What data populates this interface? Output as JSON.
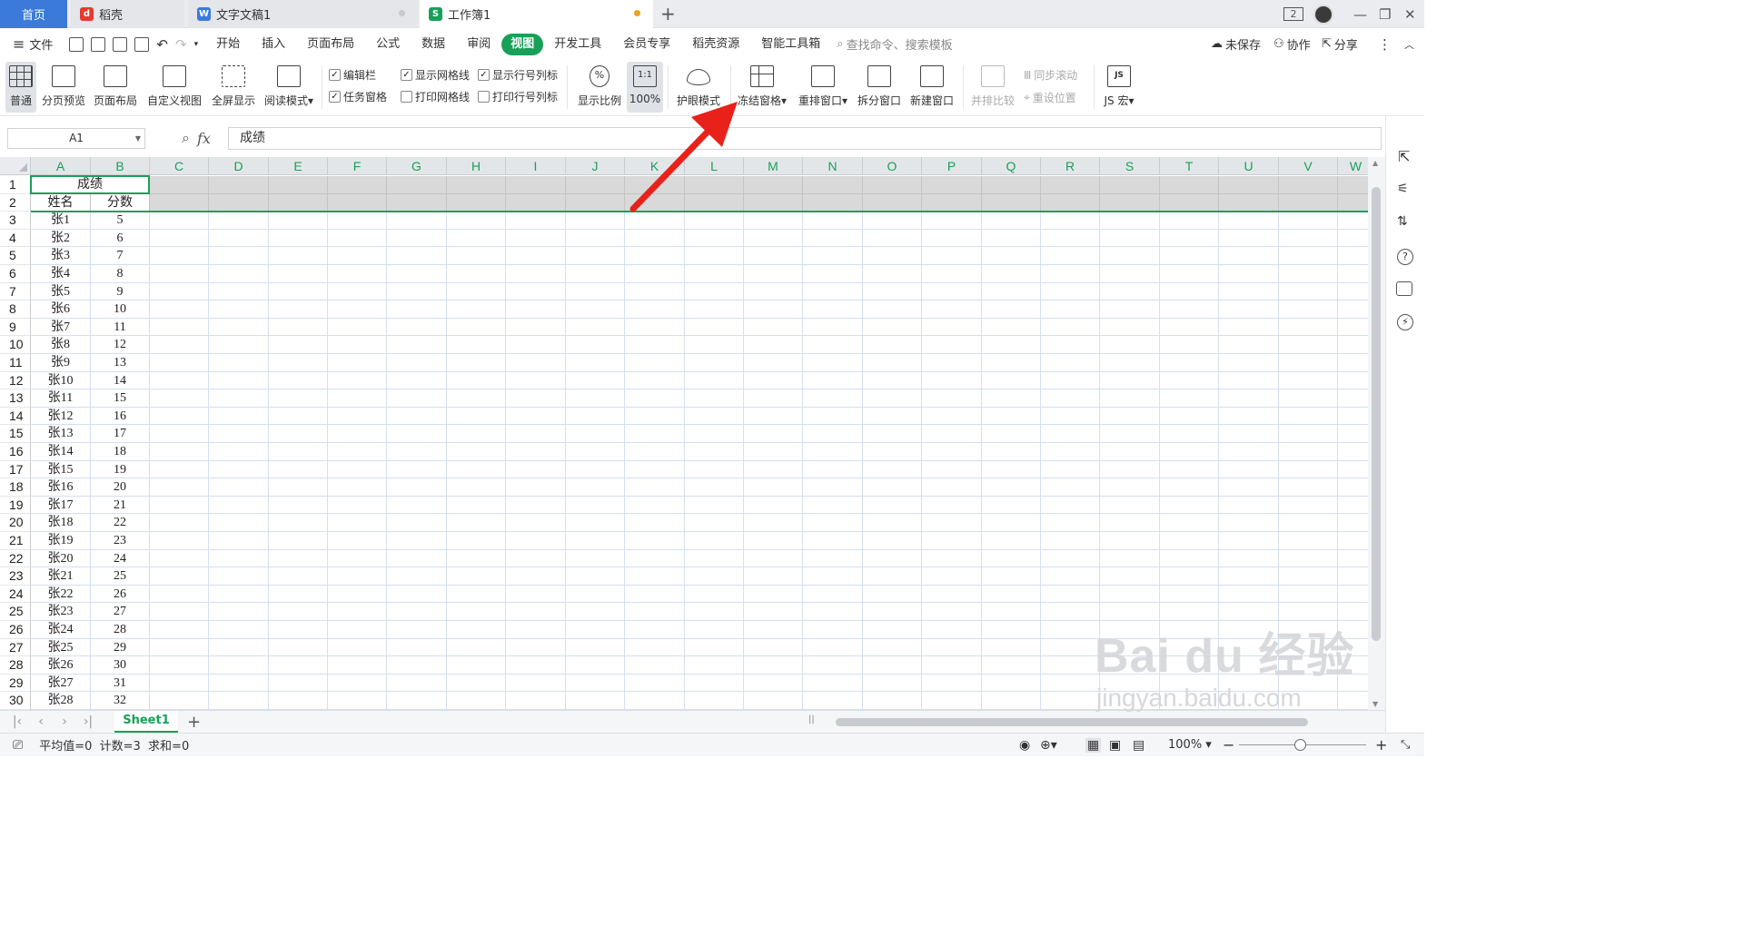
{
  "tabs": [
    {
      "label": "首页"
    },
    {
      "label": "稻壳",
      "icon": "daoke-icon"
    },
    {
      "label": "文字文稿1",
      "icon": "word-doc-icon"
    },
    {
      "label": "工作簿1",
      "icon": "spreadsheet-icon"
    }
  ],
  "window": {
    "badge": "2"
  },
  "menu": {
    "file_label": "文件",
    "items": [
      "开始",
      "插入",
      "页面布局",
      "公式",
      "数据",
      "审阅",
      "视图",
      "开发工具",
      "会员专享",
      "稻壳资源",
      "智能工具箱"
    ],
    "active": "视图",
    "search_placeholder": "查找命令、搜索模板",
    "unsaved": "未保存",
    "collab": "协作",
    "share": "分享"
  },
  "ribbon": {
    "normal": "普通",
    "page_break_preview": "分页预览",
    "page_layout": "页面布局",
    "custom_view": "自定义视图",
    "fullscreen": "全屏显示",
    "reading_mode": "阅读模式",
    "edit_bar": "编辑栏",
    "task_pane": "任务窗格",
    "show_gridlines": "显示网格线",
    "print_gridlines": "打印网格线",
    "show_headers": "显示行号列标",
    "print_headers": "打印行号列标",
    "zoom_ratio": "显示比例",
    "zoom_100": "100%",
    "zoom_100_icon_text": "1:1",
    "eye_protect": "护眼模式",
    "freeze_panes": "冻结窗格",
    "arrange_windows": "重排窗口",
    "split_window": "拆分窗口",
    "new_window": "新建窗口",
    "side_by_side": "并排比较",
    "sync_scroll": "同步滚动",
    "reset_position": "重设位置",
    "js_macro": "JS 宏",
    "js_icon_text": "JS"
  },
  "checkboxes": {
    "edit_bar": true,
    "task_pane": true,
    "show_gridlines": true,
    "print_gridlines": false,
    "show_headers": true,
    "print_headers": false
  },
  "formula": {
    "namebox": "A1",
    "fx": "fx",
    "content": "成绩"
  },
  "columns": [
    "A",
    "B",
    "C",
    "D",
    "E",
    "F",
    "G",
    "H",
    "I",
    "J",
    "K",
    "L",
    "M",
    "N",
    "O",
    "P",
    "Q",
    "R",
    "S",
    "T",
    "U",
    "V",
    "W"
  ],
  "sheet": {
    "title": "成绩",
    "headers": [
      "姓名",
      "分数"
    ],
    "rows": [
      [
        "张1",
        "5"
      ],
      [
        "张2",
        "6"
      ],
      [
        "张3",
        "7"
      ],
      [
        "张4",
        "8"
      ],
      [
        "张5",
        "9"
      ],
      [
        "张6",
        "10"
      ],
      [
        "张7",
        "11"
      ],
      [
        "张8",
        "12"
      ],
      [
        "张9",
        "13"
      ],
      [
        "张10",
        "14"
      ],
      [
        "张11",
        "15"
      ],
      [
        "张12",
        "16"
      ],
      [
        "张13",
        "17"
      ],
      [
        "张14",
        "18"
      ],
      [
        "张15",
        "19"
      ],
      [
        "张16",
        "20"
      ],
      [
        "张17",
        "21"
      ],
      [
        "张18",
        "22"
      ],
      [
        "张19",
        "23"
      ],
      [
        "张20",
        "24"
      ],
      [
        "张21",
        "25"
      ],
      [
        "张22",
        "26"
      ],
      [
        "张23",
        "27"
      ],
      [
        "张24",
        "28"
      ],
      [
        "张25",
        "29"
      ],
      [
        "张26",
        "30"
      ],
      [
        "张27",
        "31"
      ],
      [
        "张28",
        "32"
      ]
    ]
  },
  "sheet_tabs": [
    "Sheet1"
  ],
  "status": {
    "summary": "平均值=0  计数=3  求和=0",
    "zoom": "100%"
  },
  "watermark": {
    "logo": "Bai du 经验",
    "url": "jingyan.baidu.com"
  },
  "colors": {
    "accent": "#18a058",
    "home_tab": "#3b7ad8",
    "annotation_arrow": "#e8221b",
    "frozen_header_bg": "#d9d9d9"
  }
}
